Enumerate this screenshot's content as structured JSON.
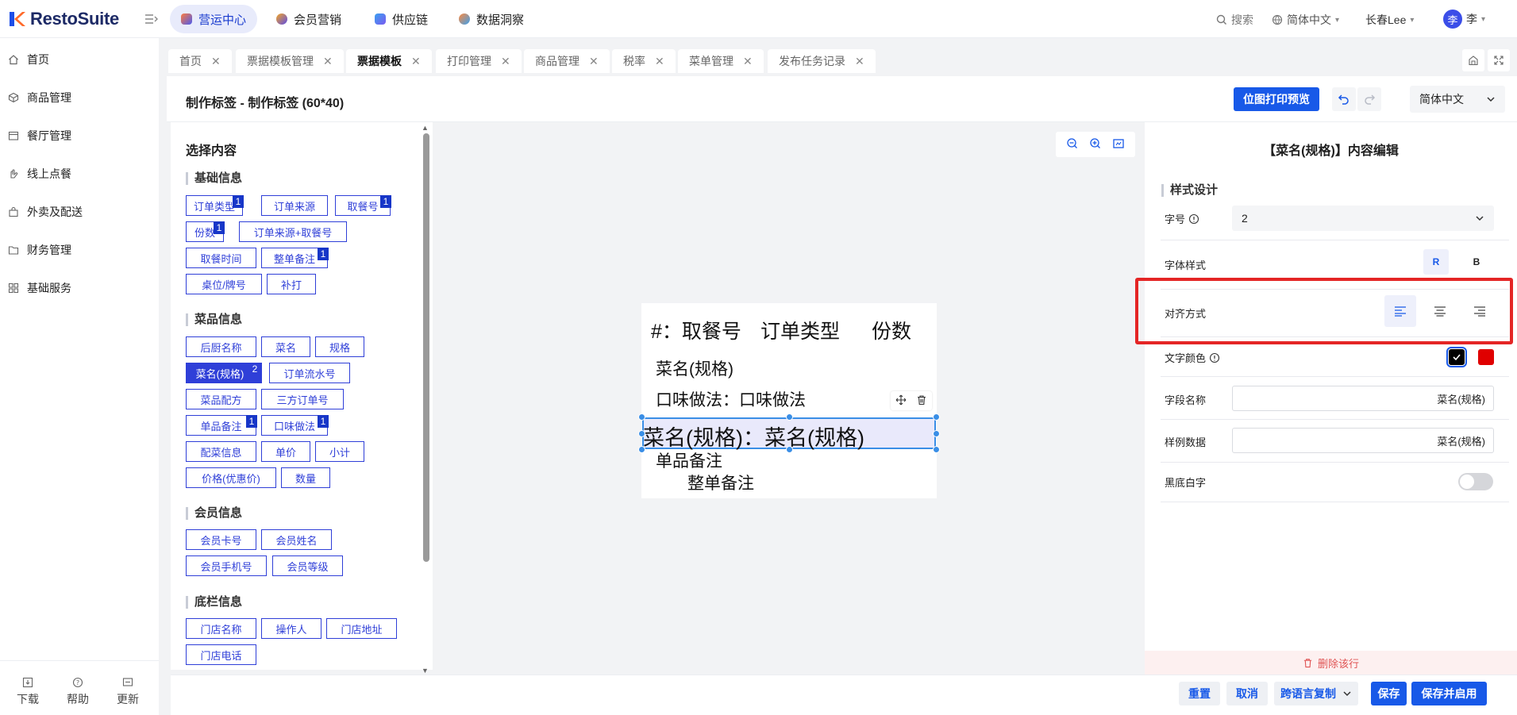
{
  "app": {
    "name": "RestoSuite"
  },
  "topnav": {
    "tabs": [
      {
        "label": "营运中心",
        "color": "#ff7a3d"
      },
      {
        "label": "会员营销",
        "color": "#5b4be8"
      },
      {
        "label": "供应链",
        "color": "#7a5bf0"
      },
      {
        "label": "数据洞察",
        "color": "#3aa0f0"
      }
    ],
    "search": "搜索",
    "language": "简体中文",
    "city": "长春Lee",
    "user_initial": "李",
    "user_name": "李"
  },
  "sidebar": {
    "items": [
      "首页",
      "商品管理",
      "餐厅管理",
      "线上点餐",
      "外卖及配送",
      "财务管理",
      "基础服务"
    ],
    "bottom": [
      "下载",
      "帮助",
      "更新"
    ]
  },
  "page_tabs": [
    "首页",
    "票据模板管理",
    "票据模板",
    "打印管理",
    "商品管理",
    "税率",
    "菜单管理",
    "发布任务记录"
  ],
  "header": {
    "title": "制作标签 - 制作标签 (60*40)",
    "preview_button": "位图打印预览",
    "language": "简体中文"
  },
  "left": {
    "title": "选择内容",
    "groups": [
      {
        "title": "基础信息",
        "chips": [
          {
            "label": "订单类型",
            "badge": "1"
          },
          {
            "label": "订单来源",
            "badge": ""
          },
          {
            "label": "取餐号",
            "badge": "1"
          },
          {
            "label": "份数",
            "badge": "1"
          },
          {
            "label": "订单来源+取餐号",
            "badge": ""
          },
          {
            "label": "取餐时间",
            "badge": ""
          },
          {
            "label": "整单备注",
            "badge": "1"
          },
          {
            "label": "桌位/牌号",
            "badge": ""
          },
          {
            "label": "补打",
            "badge": ""
          }
        ]
      },
      {
        "title": "菜品信息",
        "chips": [
          {
            "label": "后厨名称",
            "badge": ""
          },
          {
            "label": "菜名",
            "badge": ""
          },
          {
            "label": "规格",
            "badge": ""
          },
          {
            "label": "菜名(规格)",
            "badge": "2"
          },
          {
            "label": "订单流水号",
            "badge": ""
          },
          {
            "label": "菜品配方",
            "badge": ""
          },
          {
            "label": "三方订单号",
            "badge": ""
          },
          {
            "label": "单品备注",
            "badge": "1"
          },
          {
            "label": "口味做法",
            "badge": "1"
          },
          {
            "label": "配菜信息",
            "badge": ""
          },
          {
            "label": "单价",
            "badge": ""
          },
          {
            "label": "小计",
            "badge": ""
          },
          {
            "label": "价格(优惠价)",
            "badge": ""
          },
          {
            "label": "数量",
            "badge": ""
          }
        ]
      },
      {
        "title": "会员信息",
        "chips": [
          {
            "label": "会员卡号",
            "badge": ""
          },
          {
            "label": "会员姓名",
            "badge": ""
          },
          {
            "label": "会员手机号",
            "badge": ""
          },
          {
            "label": "会员等级",
            "badge": ""
          }
        ]
      },
      {
        "title": "底栏信息",
        "chips": [
          {
            "label": "门店名称",
            "badge": ""
          },
          {
            "label": "操作人",
            "badge": ""
          },
          {
            "label": "门店地址",
            "badge": ""
          },
          {
            "label": "门店电话",
            "badge": ""
          }
        ]
      }
    ]
  },
  "canvas": {
    "line1_a": "#：取餐号",
    "line1_b": "订单类型",
    "line1_c": "份数",
    "line2": "菜名(规格)",
    "line3": "口味做法：口味做法",
    "line4": "菜名(规格)：菜名(规格)",
    "line5": "单品备注",
    "line6": "整单备注"
  },
  "right": {
    "title": "【菜名(规格)】内容编辑",
    "section": "样式设计",
    "font_size_label": "字号",
    "font_size_value": "2",
    "font_style_label": "字体样式",
    "font_style_regular": "R",
    "font_style_bold": "B",
    "align_label": "对齐方式",
    "color_label": "文字颜色",
    "colors": [
      "#000000",
      "#e00000"
    ],
    "field_name_label": "字段名称",
    "field_name_value": "菜名(规格)",
    "sample_label": "样例数据",
    "sample_value": "菜名(规格)",
    "inverse_label": "黑底白字",
    "delete_row": "删除该行"
  },
  "footer": {
    "reset": "重置",
    "cancel": "取消",
    "copy": "跨语言复制",
    "save": "保存",
    "save_enable": "保存并启用"
  }
}
